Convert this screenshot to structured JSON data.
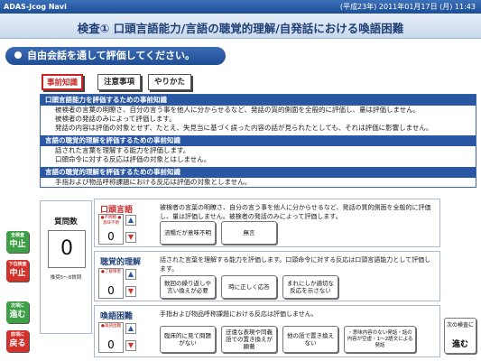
{
  "titlebar": {
    "app": "ADAS-Jcog Navi",
    "datetime": "(平成23年) 2011年01月17日 (月) 11:43"
  },
  "header": {
    "title": "検査① 口頭言語能力/言語の聴覚的理解/自発話における喚語困難"
  },
  "banner": {
    "text": "自由会話を通して評価してください。"
  },
  "tabs": [
    "事前知識",
    "注意事項",
    "やりかた"
  ],
  "knowledge": [
    {
      "heading": "口頭言語能力を評価するための事前知識",
      "lines": [
        "被検者の言葉の明瞭さ、自分の言う事を他人に分からせるなど、発話の質的側面を全般的に評価し、量は評価しません。",
        "被検者の発話のみによって評価します。",
        "発話の内容は評価の対象とせず、たとえ、失見当に基づく誤った内容の話が見られたとしても、それは評価に影響しません。"
      ]
    },
    {
      "heading": "言語の聴覚的理解を評価するための事前知識",
      "lines": [
        "話された言葉を理解する能力を評価します。",
        "口頭命令に対する反応は評価の対象とはしません。"
      ]
    },
    {
      "heading": "言語の聴覚的理解を評価するための事前知識",
      "lines": [
        "手指および物品呼称課題における反応は評価の対象としません。"
      ]
    }
  ],
  "sidebar": [
    {
      "small": "全検査",
      "big": "中止",
      "color": "green"
    },
    {
      "small": "下位検査",
      "big": "中止",
      "color": "red"
    },
    {
      "small": "次項に",
      "big": "進む",
      "color": "green"
    },
    {
      "small": "前項に",
      "big": "戻る",
      "color": "red"
    }
  ],
  "count": {
    "label": "質問数",
    "value": "0",
    "note": "推奨5～8質問"
  },
  "panels": [
    {
      "title": "口頭言語",
      "title_color": "#c62828",
      "desc": "被検者の言葉の明瞭さ、自分の言う事を他人に分からせるなど、発話の質的側面を全般的に評価し、量は評価しません。被検者の発話のみによって評価します。",
      "counter_label": "●不明瞭 ●意味不明",
      "counter_value": "0",
      "options": [
        "流暢だが意味不明",
        "無言"
      ]
    },
    {
      "title": "聴覚的理解",
      "title_color": "#1f3f75",
      "desc": "話された言葉を理解する能力を評価します。口頭命令に対する反応は口頭言語能力として評価します。",
      "counter_label": "●了解障害",
      "counter_value": "0",
      "options": [
        "数回の繰り返しや言い換えが必要",
        "時に正しく応答",
        "まれにしか適切な反応を示さない"
      ]
    },
    {
      "title": "喚語困難",
      "title_color": "#1f3f75",
      "desc": "手指および物品呼称課題における反応は評価しません。",
      "counter_label": "●喚語困難",
      "counter_value": "0",
      "options": [
        "臨床的に見て問題がない",
        "迂遠な表現や同義語での置き換えが顕著",
        "他の語で置き換えない",
        "・意味内容のない発話・話の内容が空虚・1～2語文による発話"
      ]
    }
  ],
  "next": {
    "small": "次の検査に",
    "big": "進む"
  }
}
